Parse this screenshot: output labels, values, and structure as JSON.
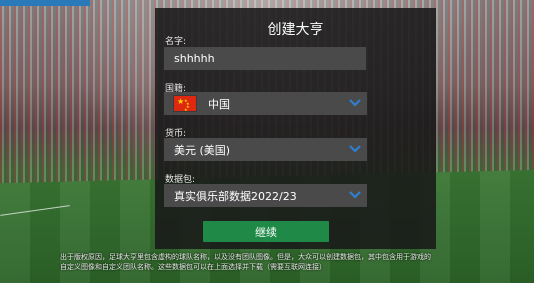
{
  "dialog": {
    "title": "创建大亨",
    "name": {
      "label": "名字:",
      "value": "shhhhh"
    },
    "nationality": {
      "label": "国籍:",
      "value": "中国",
      "flag": "china-flag-icon"
    },
    "currency": {
      "label": "货币:",
      "value": "美元 (美国)"
    },
    "data_pack": {
      "label": "数据包:",
      "value": "真实俱乐部数据2022/23"
    },
    "continue_label": "继续"
  },
  "footer": {
    "line1": "出于版权原因，足球大亨里包含虚构的球队名称，以及没有团队图像。但是，大众可以创建数据包，其中包含用于游戏的",
    "line2": "自定义图像和自定义团队名称。这些数据包可以在上面选择并下载（需要互联网连接）"
  },
  "colors": {
    "accent": "#1f8a47",
    "chevron": "#2f7fd1",
    "panel": "#191919",
    "field": "#4a4a4a"
  }
}
